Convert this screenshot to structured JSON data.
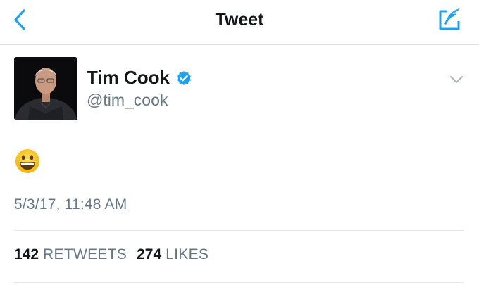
{
  "navbar": {
    "title": "Tweet",
    "back_icon": "chevron-left-icon",
    "compose_icon": "compose-tweet-icon",
    "accent_color": "#1da1f2"
  },
  "tweet": {
    "author": {
      "display_name": "Tim Cook",
      "handle": "@tim_cook",
      "verified": true,
      "verified_color": "#1da1f2"
    },
    "text_emoji": "grinning-face-emoji",
    "timestamp": "5/3/17, 11:48 AM",
    "stats": {
      "retweets_count": "142",
      "retweets_label": "RETWEETS",
      "likes_count": "274",
      "likes_label": "LIKES"
    }
  }
}
